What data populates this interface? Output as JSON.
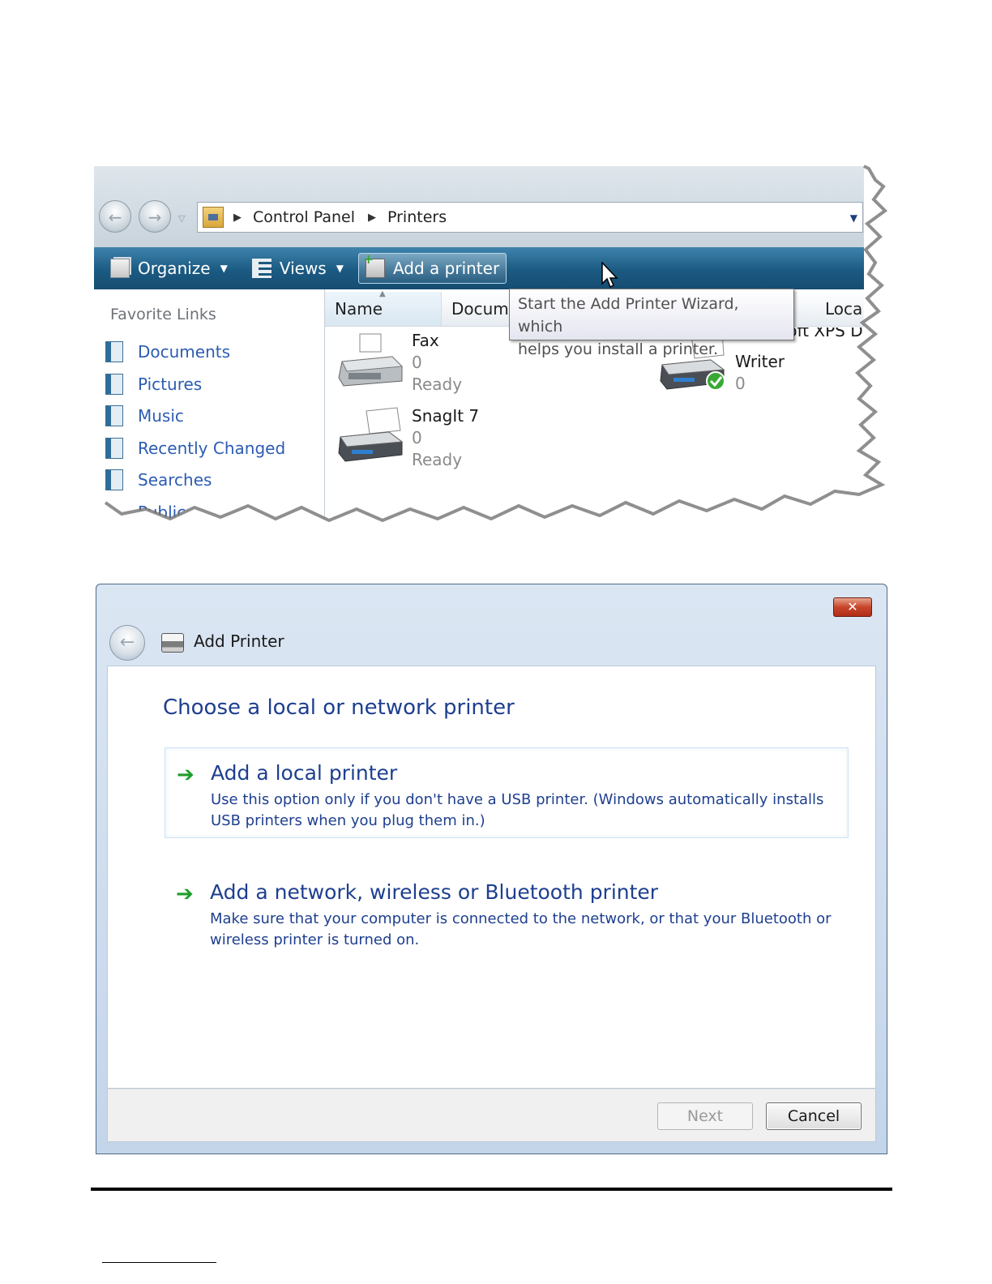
{
  "explorer": {
    "breadcrumb": [
      "Control Panel",
      "Printers"
    ],
    "toolbar": {
      "organize": "Organize",
      "views": "Views",
      "add_printer": "Add a printer"
    },
    "sidebar": {
      "title": "Favorite Links",
      "items": [
        {
          "label": "Documents",
          "icon": "documents-icon"
        },
        {
          "label": "Pictures",
          "icon": "pictures-icon"
        },
        {
          "label": "Music",
          "icon": "music-icon"
        },
        {
          "label": "Recently Changed",
          "icon": "recently-changed-icon"
        },
        {
          "label": "Searches",
          "icon": "searches-icon"
        },
        {
          "label": "Public",
          "icon": "public-icon"
        }
      ]
    },
    "columns": {
      "name": "Name",
      "documents": "Docum",
      "location": "Loca"
    },
    "tooltip": {
      "line1": "Start the Add Printer Wizard, which",
      "line2": "helps you install a printer."
    },
    "printers": [
      {
        "name": "Fax",
        "jobs": "0",
        "status": "Ready",
        "icon": "fax-icon"
      },
      {
        "name": "SnagIt 7",
        "jobs": "0",
        "status": "Ready",
        "icon": "printer-icon"
      },
      {
        "name_line1": "Microsoft XPS D",
        "name_line2": "Writer",
        "jobs": "0",
        "icon": "default-printer-icon"
      }
    ]
  },
  "dialog": {
    "title": "Add Printer",
    "heading": "Choose a local or network printer",
    "options": [
      {
        "title": "Add a local printer",
        "description": "Use this option only if you don't have a USB printer. (Windows automatically installs USB printers when you plug them in.)"
      },
      {
        "title": "Add a network, wireless or Bluetooth printer",
        "description": "Make sure that your computer is connected to the network, or that your Bluetooth or wireless printer is turned on."
      }
    ],
    "buttons": {
      "next": "Next",
      "cancel": "Cancel",
      "close": "✕"
    }
  },
  "colors": {
    "toolbar": "#1b5a82",
    "link": "#2c5cb3",
    "dialog_text": "#1e3f8f",
    "option_arrow": "#1f9d2a",
    "close_button": "#c6452b"
  }
}
